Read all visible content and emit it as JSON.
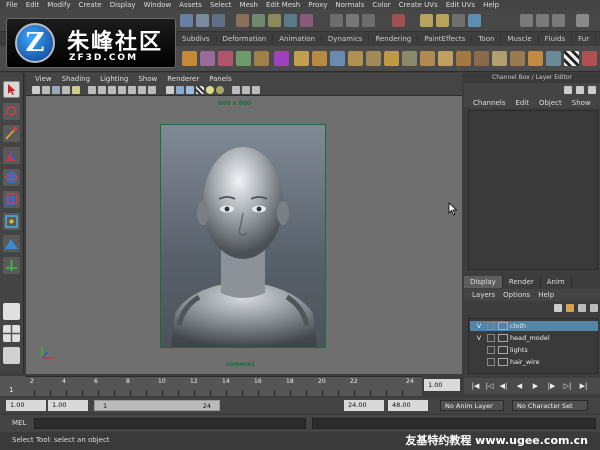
{
  "menubar": [
    "File",
    "Edit",
    "Modify",
    "Create",
    "Display",
    "Window",
    "Assets",
    "Select",
    "Mesh",
    "Edit Mesh",
    "Proxy",
    "Normals",
    "Color",
    "Create UVs",
    "Edit UVs",
    "Help"
  ],
  "logo": {
    "cn": "朱峰社区",
    "en": "ZF3D.COM",
    "mark": "Z"
  },
  "shelf_tabs": [
    "Subdivs",
    "Deformation",
    "Animation",
    "Dynamics",
    "Rendering",
    "PaintEffects",
    "Toon",
    "Muscle",
    "Fluids",
    "Fur"
  ],
  "panel_menu": [
    "View",
    "Shading",
    "Lighting",
    "Show",
    "Renderer",
    "Panels"
  ],
  "viewport": {
    "resolution_label": "600 x 800",
    "camera_label": "camera1"
  },
  "channel_box": {
    "title": "Channel Box / Layer Editor",
    "menu": [
      "Channels",
      "Edit",
      "Object",
      "Show"
    ]
  },
  "layer_editor": {
    "tabs": [
      "Display",
      "Render",
      "Anim"
    ],
    "active_tab": "Display",
    "menu": [
      "Layers",
      "Options",
      "Help"
    ],
    "layers": [
      {
        "visible": "V",
        "name": "cloth",
        "selected": true
      },
      {
        "visible": "V",
        "name": "head_model",
        "selected": false
      },
      {
        "visible": "",
        "name": "lights",
        "selected": false
      },
      {
        "visible": "",
        "name": "hair_wire",
        "selected": false
      }
    ]
  },
  "timeline": {
    "ticks": [
      "2",
      "4",
      "6",
      "8",
      "10",
      "12",
      "14",
      "16",
      "18",
      "20",
      "22",
      "24"
    ],
    "start_label": "1",
    "current_frame": "1.00"
  },
  "range": {
    "start_time": "1.00",
    "playback_start": "1.00",
    "range_start": "1",
    "range_end": "24",
    "playback_end": "24.00",
    "end_time": "48.00",
    "anim_layer": "No Anim Layer",
    "character_set": "No Character Set"
  },
  "command_line": {
    "label": "MEL"
  },
  "help_line": {
    "text": "Select Tool: select an object",
    "watermark": "友基特约教程  www.ugee.com.cn"
  },
  "colors": {
    "accent": "#5285a6",
    "gate": "#1a6e3c",
    "background": "#3d3d3d"
  }
}
